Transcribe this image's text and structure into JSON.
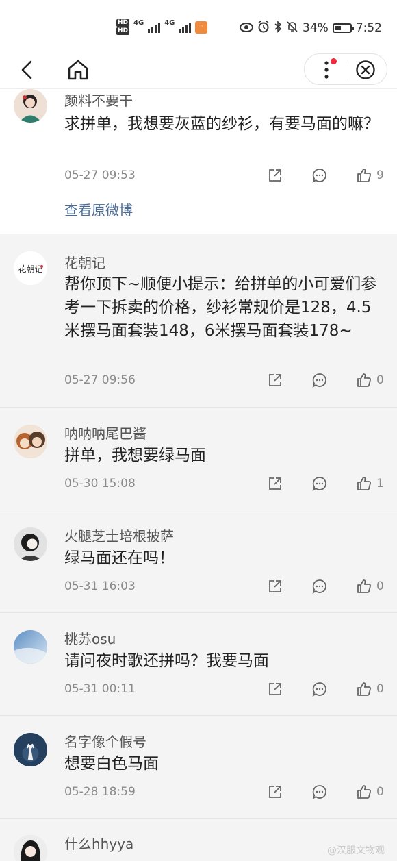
{
  "status_bar": {
    "hd1": "HD",
    "hd2": "HD",
    "net1": "4G",
    "net2": "4G",
    "battery_pct": "34%",
    "time": "7:52"
  },
  "nav": {
    "back_icon": "chevron-left-icon",
    "home_icon": "home-icon",
    "more_icon": "more-vertical-icon",
    "close_icon": "close-circle-icon",
    "notify_color": "#f0283c"
  },
  "comments": [
    {
      "username": "颜料不要干",
      "text": "求拼单，我想要灰蓝的纱衫，有要马面的嘛？",
      "time": "05-27 09:53",
      "likes": "9",
      "view_original": "查看原微博"
    },
    {
      "username": "花朝记",
      "avatar_text": "花朝记",
      "text": "帮你顶下~顺便小提示：给拼单的小可爱们参考一下拆卖的价格，纱衫常规价是128，4.5米摆马面套装148，6米摆马面套装178~",
      "time": "05-27 09:56",
      "likes": "0"
    },
    {
      "username": "呐呐呐尾巴酱",
      "text": "拼单，我想要绿马面",
      "time": "05-30 15:08",
      "likes": "1"
    },
    {
      "username": "火腿芝士培根披萨",
      "text": "绿马面还在吗！",
      "time": "05-31 16:03",
      "likes": "0"
    },
    {
      "username": "桃苏osu",
      "text": "请问夜时歌还拼吗？我要马面",
      "time": "05-31 00:11",
      "likes": "0"
    },
    {
      "username": "名字像个假号",
      "text": "想要白色马面",
      "time": "05-28 18:59",
      "likes": "0"
    },
    {
      "username": "什么hhyya"
    }
  ],
  "watermark": "@汉服文物观",
  "colors": {
    "link": "#4a6b94",
    "meta": "#8a8a8a",
    "page_bg": "#f4f4f4"
  }
}
